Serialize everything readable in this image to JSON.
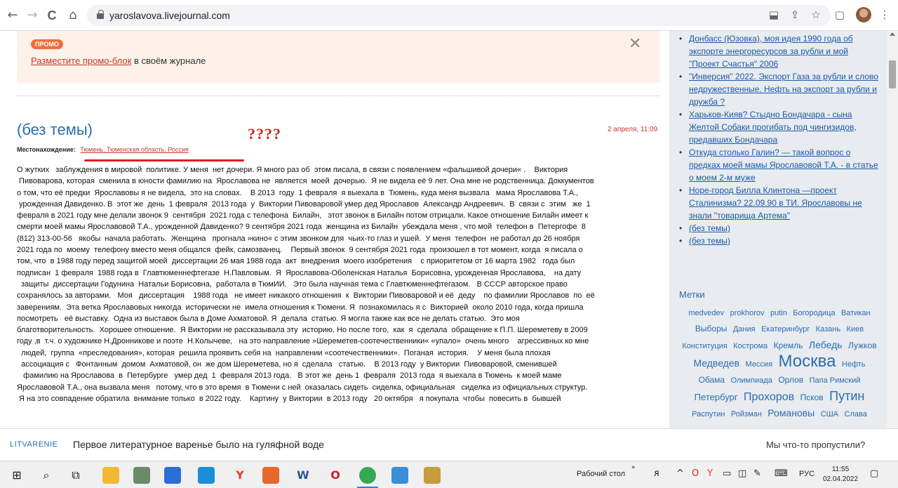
{
  "browser": {
    "url": "yaroslavova.livejournal.com",
    "nav": {
      "back": "←",
      "forward": "→",
      "reload": "C",
      "home": "⌂"
    },
    "icons": [
      "install-icon",
      "share-icon",
      "star-icon",
      "sidepanel-icon",
      "profile-avatar",
      "menu-icon"
    ]
  },
  "promo": {
    "badge": "ПРОМО",
    "link": "Разместите промо-блок",
    "rest": " в своём журнале"
  },
  "post": {
    "title": "(без темы)",
    "annotation": "????",
    "date": "2 апреля, 11:09",
    "location_label": "Местонахождение:",
    "location_value": "Тюмень, Тюменская область, Россия",
    "lines": [
      "О жутких   заблуждения в мировой  политике. У меня  нет дочери. Я много раз об  этом писала, в связи с появлением «фальшивой дочери« .    Виктория",
      " Пивоварова, которая  сменила в юности фамилию на  Ярославова не  является  моей  дочерью.  Я не видела её 9 лет. Она мне не родственница. Доккументов",
      "о том, что её предки  Ярославовы я не видела,  это на словах.    В 2013  году  1 февраля  я выехала в  Тюмень, куда меня вызвала   мама Ярославова Т.А.,",
      " урожденная Давиденко. В  этот же  день  1 февраля  2013 года  у  Виктории Пивоваровой умер дед Ярославов  Александр Андреевич.  В  связи с  этим   же  1",
      "февраля в 2021 году мне делали звонок 9  сентября  2021 года с телефона  Билайн,   этот звонок в Билайн потом отрицали. Какое отношение Билайн имеет к",
      "смерти моей мамы Ярославовой Т.А., урожденной Давиденко? 9 сентября 2021 года  женщина из Билайн  убеждала меня , что мой  телефон в  Петергофе  8",
      "(812) 313-00-56   якобы  начала работать.  Женщина   прогнала »кино« с этим звонком для  чьих-то глаз и ушей.  У меня  телефон  не работал до 26 ноября",
      "2021 года по  моему  телефону вместо меня общался  фейк, самозванец.    Первый звонок  9 сентября 2021 года  произошел в тот момент, когда  я писала о",
      "том, что  в 1988 году перед защитой моей  диссертации 26 мая 1988 года  акт  внедрения  моего изобретения    с приоритетом от 16 марта 1982   года был",
      "подписан  1 февраля  1988 года в  Главтюменнефтегазе  Н.Павловым.  Я  Ярославова-Оболенская Наталья  Борисовна, урожденная Ярославова,    на дату",
      "  защиты  диссертации Годунина  Натальи Борисовна,  работала в ТюмИИ.   Это была научная тема с Главтюменнефтегазом.   В СССР авторское право",
      "сохранялось за авторами.   Моя   диссертация    1988 года   не имеет никакого отношения  к  Виктории Пивоваровой и её  деду    по фамилии Ярославов  по  её",
      "заверениям.  Эта ветка Ярославовых никогда  исторически не  имела отношения к Тюмени. Я  познакомилась я с  Викторией  около 2010 года, когда пришла",
      "посмотреть   её выставку.  Одна из выставок была в Доме Ахматовой. Я  делала  статью. Я могла также как все не делать статью.  Это моя",
      "благотворительность.  Хорошее отношение.  Я Виктории не рассказывала эту  историю. Но после того,  как  я  сделала  обращение к П.П. Шереметеву в 2009",
      "году ,в  т.ч. о художнике Н.Дронникове и поэте  Н.Колычеве,   на это направление »Шереметев-соотечественники« «упало»  очень много    агрессивных ко мне",
      "  людей,  группа  «преследования», которая  решила проявить себя на  направлении «соотечественники».  Поганая  история.    У меня была плохая",
      "  ассоциация с   Фонтанным  домом  Ахматовой, он  же дом Шереметева, но я  сделала   статью.    В 2013 году  у Виктории  Пивоваровой, сменившей",
      "   фамилию на Ярославова  в  Петербурге   умер дед  1  февраля 2013 года.   В этот же  день 1  февраля  2013 года  я выехала в Тюмень  к моей маме",
      "Ярославовой Т.А., она вызвала меня   потому, что в это время  в Тюмени с ней  оказалась сидеть  сиделка, официальная   сиделка из официальных структур.",
      " Я на это совпадение обратила  внимание только  в 2022 году.    Картину  у Виктории  в 2013 году   20 октября   я покупала  чтобы  повесить в  бывшей"
    ]
  },
  "sidebar": {
    "items": [
      "Донбасс (Юзовка), моя идея 1990 года об экспорте энергоресурсов за рубли и мой \"Проект Счастья\" 2006",
      "\"Инверсия\" 2022. Экспорт Газа за рубли и слово недружественные. Нефть на экспорт за рубли и дружба ?",
      "Харьков-Кияв? Стыдно Бондачара - сына Желтой Собаки прогибать под чингизидов, предавших Бондачара",
      "Откуда столько Галин? — такой вопрос о предках моей мамы Ярославовой Т.А. - в статье о моем 2-м муже",
      "Норе-город Билла Клинтона —проект Сталинизма? 22.09.90 в ТИ. Ярославовы не знали \"товарища Артема\"",
      "(без темы)",
      "(без темы)"
    ],
    "tags_title": "Метки",
    "tags": [
      {
        "t": "medvedev",
        "s": 11
      },
      {
        "t": "prokhorov",
        "s": 11
      },
      {
        "t": "putin",
        "s": 11
      },
      {
        "t": "Богородица",
        "s": 11
      },
      {
        "t": "Ватикан",
        "s": 11
      },
      {
        "t": "Выборы",
        "s": 12
      },
      {
        "t": "Дания",
        "s": 11
      },
      {
        "t": "Екатеринбург",
        "s": 11
      },
      {
        "t": "Казань",
        "s": 11
      },
      {
        "t": "Киев",
        "s": 11
      },
      {
        "t": "Конституция",
        "s": 11
      },
      {
        "t": "Кострома",
        "s": 11
      },
      {
        "t": "Кремль",
        "s": 12
      },
      {
        "t": "Лебедь",
        "s": 14
      },
      {
        "t": "Лужков",
        "s": 12
      },
      {
        "t": "Медведев",
        "s": 14
      },
      {
        "t": "Мессия",
        "s": 11
      },
      {
        "t": "Москва",
        "s": 24
      },
      {
        "t": "Нефть",
        "s": 11
      },
      {
        "t": "Обама",
        "s": 12
      },
      {
        "t": "Олимпиада",
        "s": 11
      },
      {
        "t": "Орлов",
        "s": 12
      },
      {
        "t": "Папа Римский",
        "s": 11
      },
      {
        "t": "Петербург",
        "s": 13
      },
      {
        "t": "Прохоров",
        "s": 16
      },
      {
        "t": "Псков",
        "s": 12
      },
      {
        "t": "Путин",
        "s": 18
      },
      {
        "t": "Распутин",
        "s": 11
      },
      {
        "t": "Ройзман",
        "s": 11
      },
      {
        "t": "Романовы",
        "s": 14
      },
      {
        "t": "США",
        "s": 11
      },
      {
        "t": "Слава",
        "s": 11
      }
    ]
  },
  "banner": {
    "source": "LITVARENIE",
    "headline": "Первое литературное варенье было на гуляфной воде",
    "missed": "Мы что-то пропустили?"
  },
  "taskbar": {
    "desktop_label": "Рабочий стол",
    "lang": "РУС",
    "time": "11:55",
    "date": "02.04.2022",
    "apps": [
      {
        "name": "start-icon",
        "color": "#1a1a1a"
      },
      {
        "name": "search-icon",
        "color": "#1a1a1a"
      },
      {
        "name": "task-view-icon",
        "color": "#1a1a1a"
      },
      {
        "name": "file-explorer-icon",
        "color": "#f2b833"
      },
      {
        "name": "media-player-icon",
        "color": "#6a8a6a"
      },
      {
        "name": "mail-icon",
        "color": "#2b6fd6"
      },
      {
        "name": "edge-icon",
        "color": "#1a8fd8"
      },
      {
        "name": "yandex-browser-icon",
        "color": "#e63b2e"
      },
      {
        "name": "video-app-icon",
        "color": "#e8672c"
      },
      {
        "name": "word-icon",
        "color": "#2b579a"
      },
      {
        "name": "opera-icon",
        "color": "#d41b2b"
      },
      {
        "name": "chrome-icon",
        "color": "#34a853"
      },
      {
        "name": "photos-icon",
        "color": "#3b8ed8"
      },
      {
        "name": "paint-icon",
        "color": "#c89b3c"
      }
    ]
  }
}
